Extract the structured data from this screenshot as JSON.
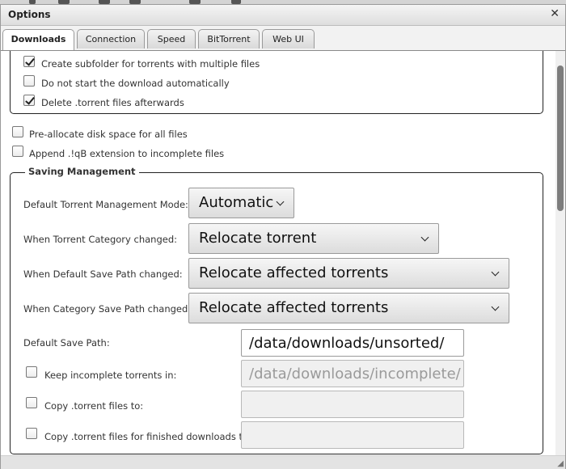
{
  "window": {
    "title": "Options",
    "close_icon": "close-icon"
  },
  "tabs": [
    {
      "label": "Downloads",
      "active": true
    },
    {
      "label": "Connection",
      "active": false
    },
    {
      "label": "Speed",
      "active": false
    },
    {
      "label": "BitTorrent",
      "active": false
    },
    {
      "label": "Web UI",
      "active": false
    }
  ],
  "torrent_options": [
    {
      "label": "Create subfolder for torrents with multiple files",
      "checked": true
    },
    {
      "label": "Do not start the download automatically",
      "checked": false
    },
    {
      "label": "Delete .torrent files afterwards",
      "checked": true
    }
  ],
  "general_options": [
    {
      "label": "Pre-allocate disk space for all files",
      "checked": false
    },
    {
      "label": "Append .!qB extension to incomplete files",
      "checked": false
    }
  ],
  "saving": {
    "legend": "Saving Management",
    "selects": [
      {
        "label": "Default Torrent Management Mode:",
        "value": "Automatic"
      },
      {
        "label": "When Torrent Category changed:",
        "value": "Relocate torrent"
      },
      {
        "label": "When Default Save Path changed:",
        "value": "Relocate affected torrents"
      },
      {
        "label": "When Category Save Path changed:",
        "value": "Relocate affected torrents"
      }
    ],
    "default_save_path": {
      "label": "Default Save Path:",
      "value": "/data/downloads/unsorted/"
    },
    "path_options": [
      {
        "label": "Keep incomplete torrents in:",
        "checked": false,
        "value": "/data/downloads/incomplete/",
        "enabled": false
      },
      {
        "label": "Copy .torrent files to:",
        "checked": false,
        "value": "",
        "enabled": false
      },
      {
        "label": "Copy .torrent files for finished downloads to:",
        "checked": false,
        "value": "",
        "enabled": false
      }
    ]
  }
}
